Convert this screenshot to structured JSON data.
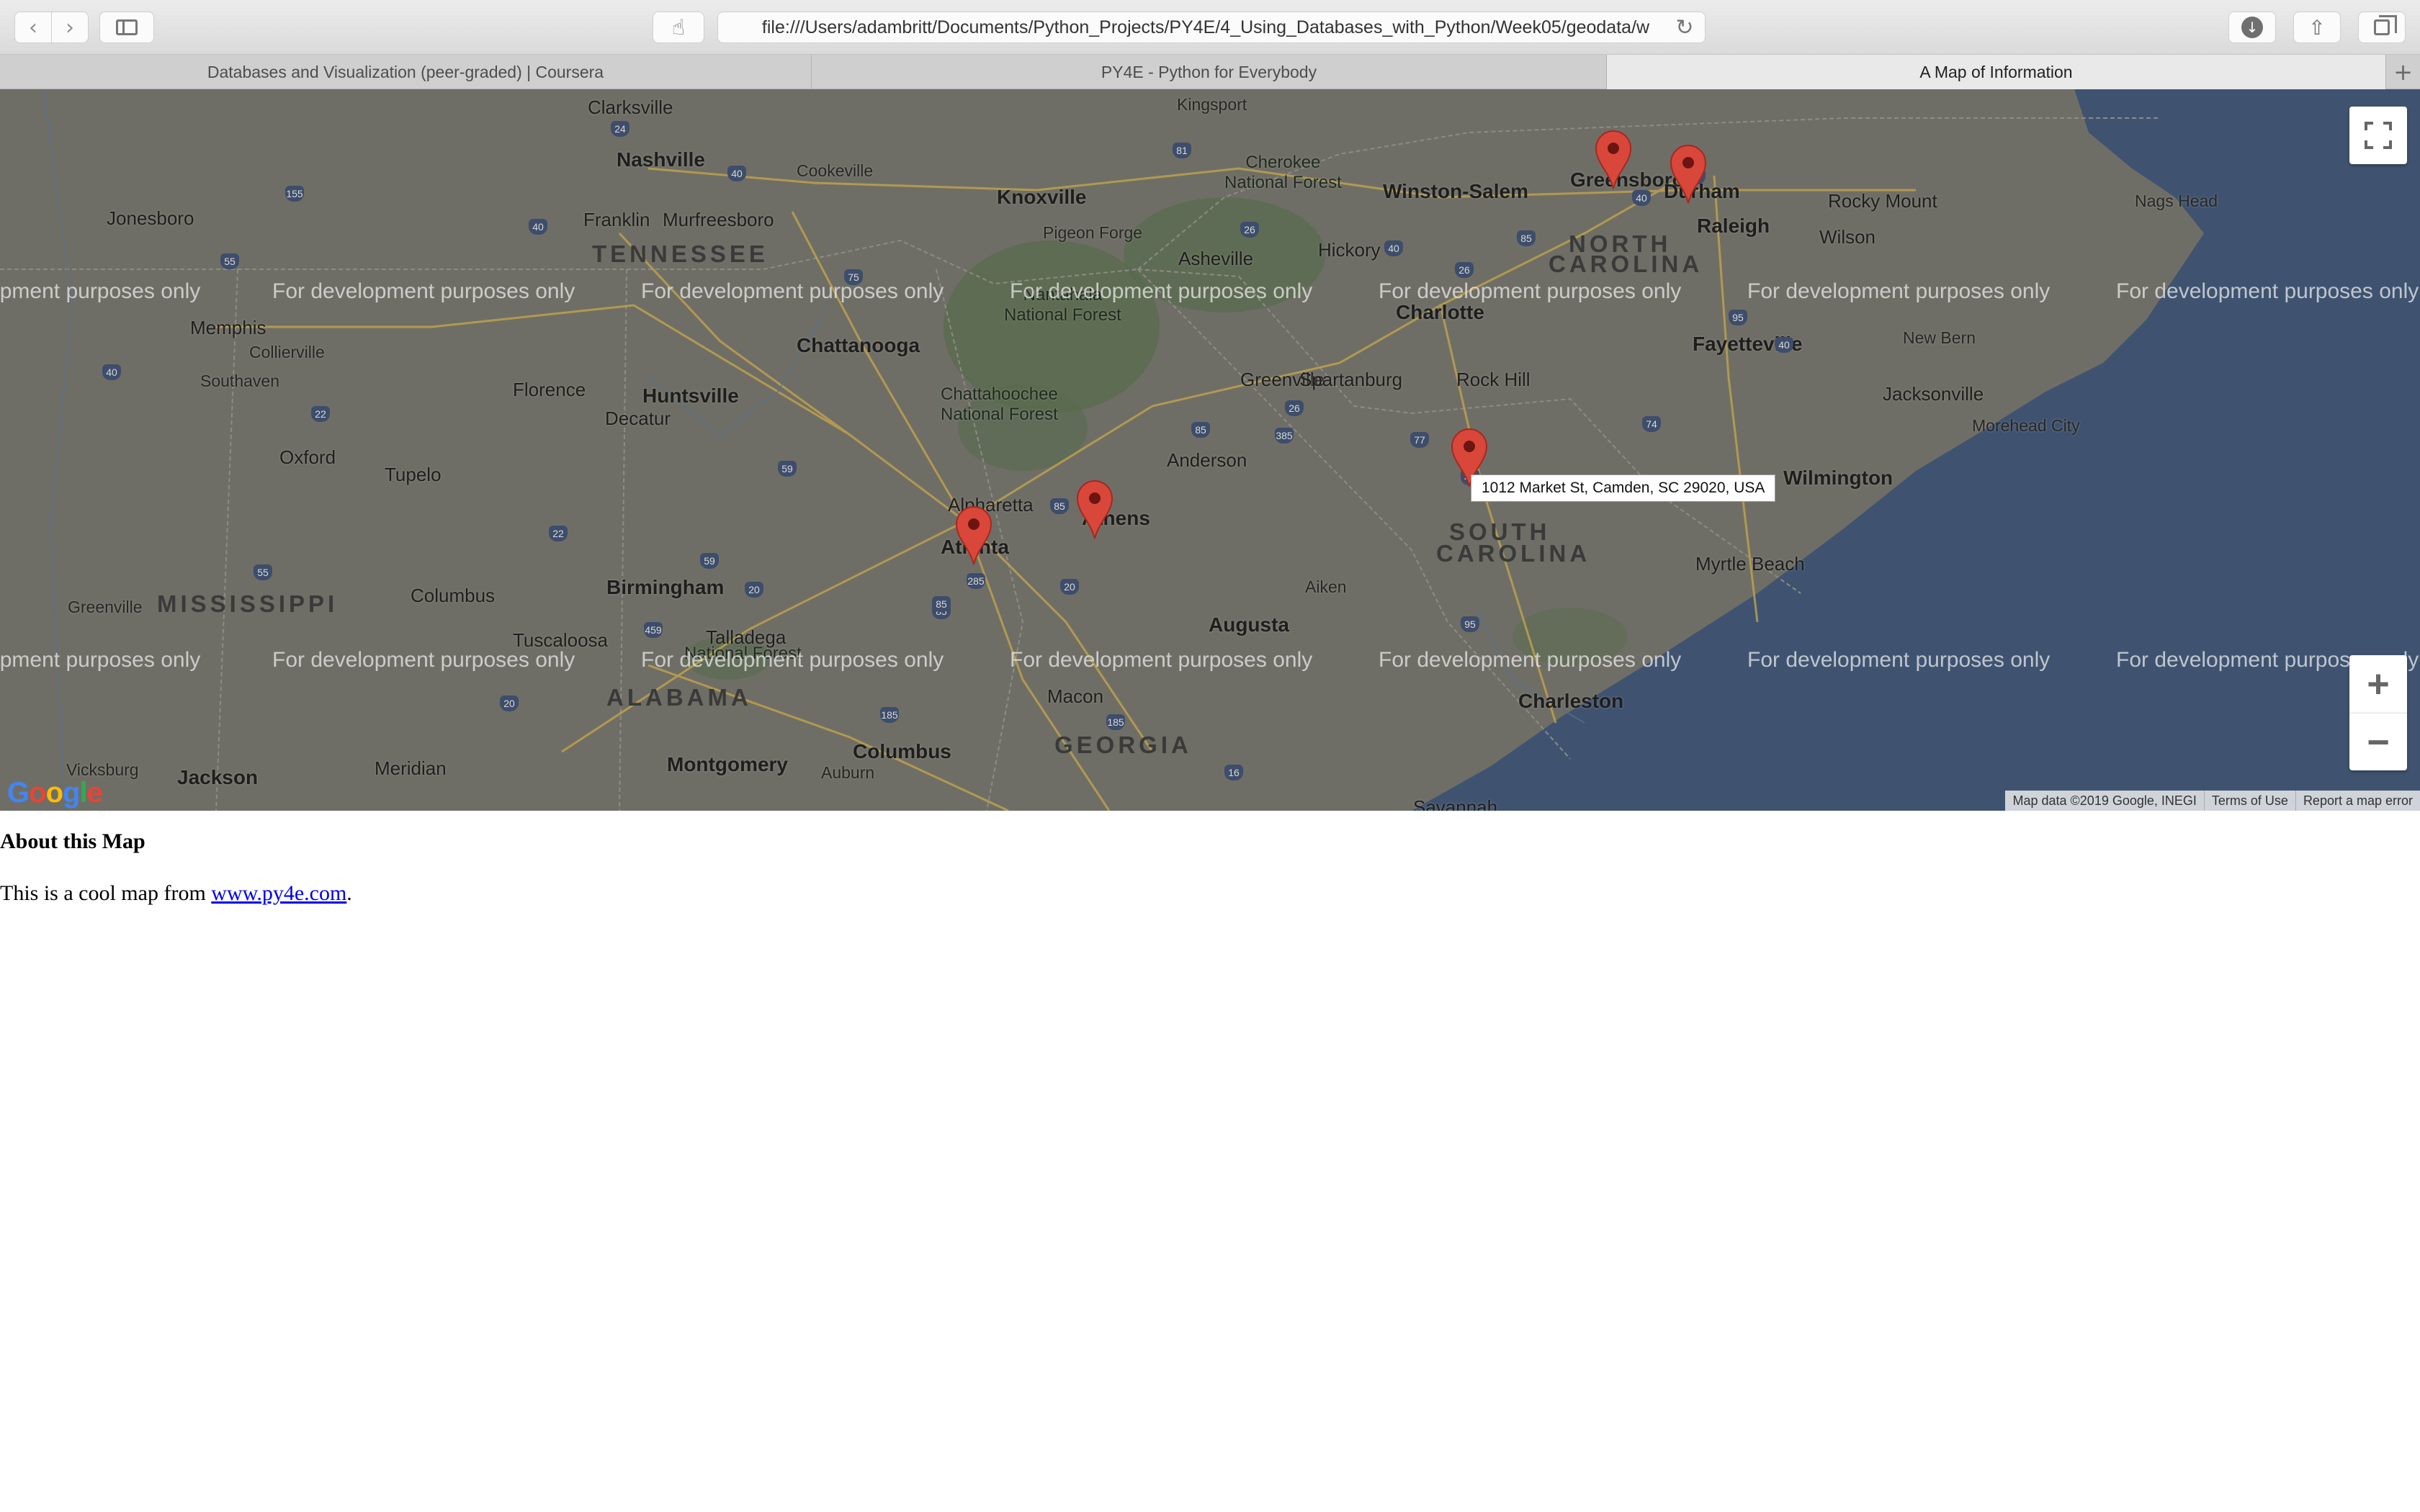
{
  "browser": {
    "url": "file:///Users/adambritt/Documents/Python_Projects/PY4E/4_Using_Databases_with_Python/Week05/geodata/w",
    "tabs": [
      {
        "label": "Databases and Visualization (peer-graded) | Coursera",
        "active": false
      },
      {
        "label": "PY4E - Python for Everybody",
        "active": false
      },
      {
        "label": "A Map of Information",
        "active": true
      }
    ],
    "icons": {
      "back": "chevron-left-icon",
      "forward": "chevron-right-icon",
      "sidebar": "sidebar-icon",
      "reader": "hand-icon",
      "reload": "reload-icon",
      "download": "download-icon",
      "share": "share-icon",
      "tabs": "tabs-overview-icon",
      "new_tab": "plus-icon"
    }
  },
  "map": {
    "watermark": "For development purposes only",
    "tooltip": "1012 Market St, Camden, SC 29020, USA",
    "attribution": {
      "data": "Map data ©2019 Google, INEGI",
      "terms": "Terms of Use",
      "report": "Report a map error"
    },
    "logo": "Google",
    "colors": {
      "land": "#6f6e66",
      "water": "#3f5371",
      "forest": "#596b4e",
      "marker": "#d9473b"
    },
    "cities": {
      "nashville": "Nashville",
      "clarksville": "Clarksville",
      "cookeville": "Cookeville",
      "franklin": "Franklin",
      "murfreesboro": "Murfreesboro",
      "jonesboro": "Jonesboro",
      "memphis": "Memphis",
      "collierville": "Collierville",
      "southaven": "Southaven",
      "knoxville": "Knoxville",
      "kingsport": "Kingsport",
      "pigeon_forge": "Pigeon Forge",
      "asheville": "Asheville",
      "chattanooga": "Chattanooga",
      "huntsville": "Huntsville",
      "florence": "Florence",
      "decatur": "Decatur",
      "tupelo": "Tupelo",
      "oxford": "Oxford",
      "columbus_ms": "Columbus",
      "birmingham": "Birmingham",
      "tuscaloosa": "Tuscaloosa",
      "talladega": "Talladega",
      "atlanta": "Atlanta",
      "alpharetta": "Alpharetta",
      "athens": "Athens",
      "anderson": "Anderson",
      "greenville": "Greenville",
      "spartanburg": "Spartanburg",
      "charlotte": "Charlotte",
      "rock_hill": "Rock Hill",
      "hickory": "Hickory",
      "winston_salem": "Winston-Salem",
      "greensboro": "Greensboro",
      "durham": "Durham",
      "raleigh": "Raleigh",
      "rocky_mount": "Rocky Mount",
      "wilson": "Wilson",
      "fayetteville": "Fayetteville",
      "new_bern": "New Bern",
      "jacksonville": "Jacksonville",
      "wilmington": "Wilmington",
      "nags_head": "Nags Head",
      "morehead_city": "Morehead City",
      "myrtle_beach": "Myrtle Beach",
      "aiken": "Aiken",
      "augusta": "Augusta",
      "macon": "Macon",
      "columbus_ga": "Columbus",
      "montgomery": "Montgomery",
      "auburn": "Auburn",
      "charleston": "Charleston",
      "savannah": "Savannah",
      "meridian": "Meridian",
      "jackson": "Jackson",
      "vicksburg": "Vicksburg",
      "greenville_ms": "Greenville",
      "cherokee_nf": "Cherokee\nNational Forest",
      "nantahala_nf": "Nantahala\nNational Forest",
      "chattahoochee_nf": "Chattahoochee\nNational Forest",
      "talladega_nf": "National Forest"
    },
    "states": {
      "tn": "TENNESSEE",
      "nc1": "NORTH",
      "nc2": "CAROLINA",
      "sc1": "SOUTH",
      "sc2": "CAROLINA",
      "ms": "MISSISSIPPI",
      "al": "ALABAMA",
      "ga": "GEORGIA"
    },
    "highways": [
      "24",
      "40",
      "155",
      "40",
      "55",
      "40",
      "22",
      "81",
      "40",
      "26",
      "85",
      "40",
      "95",
      "40",
      "85",
      "20",
      "75",
      "59",
      "85",
      "26",
      "385",
      "22",
      "55",
      "59",
      "459",
      "20",
      "85",
      "77",
      "95",
      "40",
      "74",
      "20",
      "185",
      "16",
      "20",
      "185",
      "85",
      "285",
      "26"
    ]
  },
  "page": {
    "heading": "About this Map",
    "text_before": "This is a cool map from ",
    "link_text": "www.py4e.com",
    "text_after": "."
  }
}
